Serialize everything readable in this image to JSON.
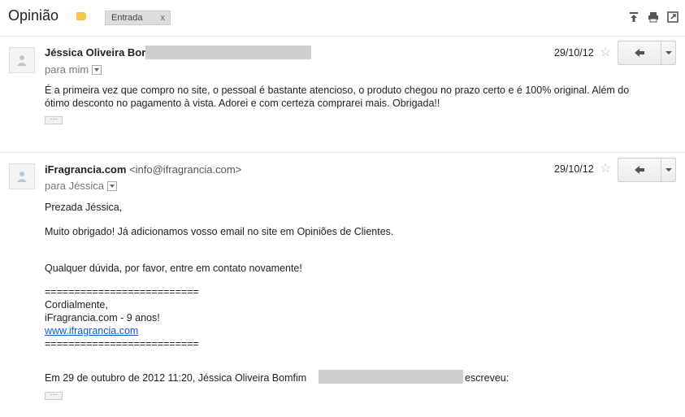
{
  "header": {
    "subject": "Opinião",
    "label_chip": "Entrada",
    "label_close": "x",
    "icons": [
      "expand-all-icon",
      "print-icon",
      "new-window-icon"
    ]
  },
  "messages": [
    {
      "sender": "Jéssica Oliveira Bor",
      "to_label": "para mim",
      "date": "29/10/12",
      "body": [
        "É a primeira vez que compro no site, o pessoal é bastante atencioso, o produto chegou no prazo certo e é 100% original. Além do",
        "ótimo desconto no pagamento à vista. Adorei e com certeza comprarei mais. Obrigada!!"
      ]
    },
    {
      "sender": "iFragrancia.com",
      "email": "<info@ifragrancia.com>",
      "to_label": "para Jéssica",
      "date": "29/10/12",
      "greeting": "Prezada Jéssica,",
      "line1": "Muito obrigado! Já adicionamos vosso email no site em Opiniões de Clientes.",
      "line2": "Qualquer dúvida, por favor, entre em contato novamente!",
      "sig_rule": "==========================",
      "sig1": "Cordialmente,",
      "sig2": "iFragrancia.com - 9 anos!",
      "sig_link": "www.ifragrancia.com",
      "quote_prefix": "Em 29 de outubro de 2012 11:20, Jéssica Oliveira Bomfim",
      "quote_suffix": "escreveu:"
    }
  ],
  "colors": {
    "label_tag": "#f5c84c",
    "link": "#1155cc",
    "redaction": "#cfcfcf"
  }
}
